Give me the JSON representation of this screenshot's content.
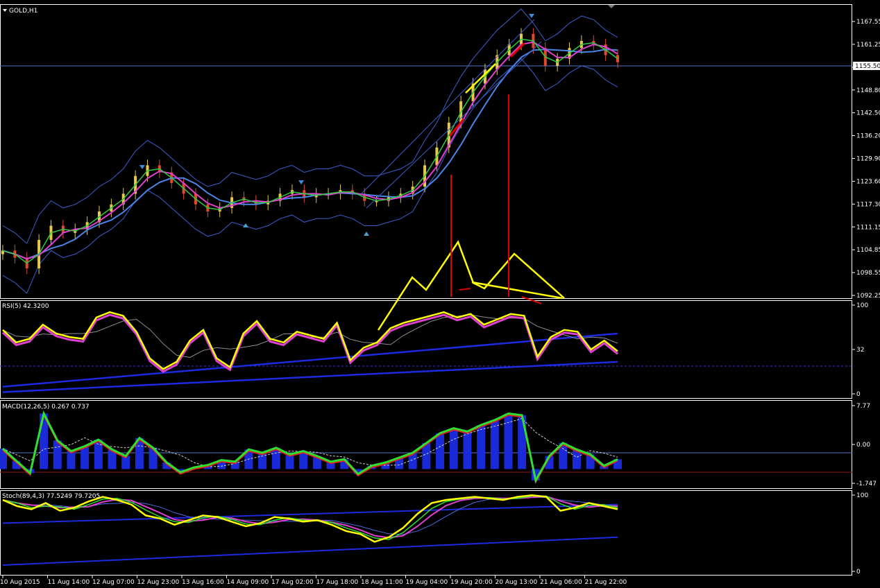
{
  "symbol_label": "GOLD,H1",
  "current_price": "1155.50",
  "chart_data": [
    {
      "type": "line",
      "panel": "price",
      "title": "GOLD,H1",
      "ylim": [
        1090,
        1170
      ],
      "y_ticks": [
        "1167.55",
        "1161.25",
        "1155.50",
        "1148.80",
        "1142.50",
        "1136.20",
        "1129.90",
        "1123.60",
        "1117.30",
        "1111.15",
        "1104.85",
        "1098.55",
        "1092.25"
      ],
      "x_ticks": [
        "10 Aug 2015",
        "11 Aug 14:00",
        "12 Aug 07:00",
        "12 Aug 23:00",
        "13 Aug 16:00",
        "14 Aug 09:00",
        "17 Aug 02:00",
        "17 Aug 18:00",
        "18 Aug 11:00",
        "19 Aug 04:00",
        "19 Aug 20:00",
        "20 Aug 13:00",
        "21 Aug 06:00",
        "21 Aug 22:00"
      ],
      "series": [
        {
          "values": [
            1103,
            1101,
            1098,
            1106,
            1110,
            1108,
            1109,
            1111,
            1114,
            1116,
            1119,
            1124,
            1127,
            1125,
            1122,
            1119,
            1116,
            1114,
            1115,
            1118,
            1117,
            1116,
            1117,
            1119,
            1120,
            1118,
            1119,
            1119,
            1120,
            1119,
            1117,
            1117,
            1118,
            1119,
            1121,
            1127,
            1132,
            1139,
            1145,
            1150,
            1154,
            1158,
            1161,
            1164,
            1160,
            1155,
            1157,
            1160,
            1162,
            1161,
            1158,
            1156
          ]
        }
      ]
    },
    {
      "type": "line",
      "panel": "rsi",
      "title": "RSI(5) 42.3200",
      "ylim": [
        0,
        100
      ],
      "y_ticks": [
        "100",
        "32",
        "0"
      ],
      "series": [
        {
          "values": [
            72,
            58,
            62,
            78,
            68,
            64,
            62,
            86,
            92,
            88,
            70,
            40,
            28,
            36,
            60,
            72,
            40,
            30,
            68,
            82,
            62,
            58,
            70,
            66,
            62,
            80,
            38,
            52,
            58,
            74,
            80,
            84,
            88,
            92,
            86,
            90,
            78,
            84,
            90,
            88,
            42,
            64,
            72,
            70,
            50,
            60,
            48
          ]
        }
      ]
    },
    {
      "type": "line",
      "panel": "macd",
      "title": "MACD(12,26,5) 0.267 0.737",
      "ylim": [
        -1.747,
        7.77
      ],
      "y_ticks": [
        "7.77",
        "0.00",
        "-1.747"
      ],
      "series": [
        {
          "values": [
            2.5,
            1.0,
            -0.5,
            6.8,
            3.5,
            2.2,
            2.8,
            3.6,
            2.4,
            1.6,
            3.8,
            2.6,
            0.8,
            -0.4,
            0.2,
            0.5,
            1.1,
            0.9,
            2.4,
            2.0,
            2.6,
            1.8,
            2.2,
            1.6,
            0.9,
            1.2,
            -0.6,
            0.4,
            0.8,
            1.4,
            2.0,
            3.2,
            4.4,
            5.0,
            4.6,
            5.4,
            6.0,
            6.8,
            6.6,
            -1.4,
            1.6,
            3.2,
            2.4,
            1.8,
            0.4,
            1.2
          ]
        }
      ]
    },
    {
      "type": "line",
      "panel": "stoch",
      "title": "Stoch(89,4,3) 77.5249 79.7205",
      "ylim": [
        0,
        100
      ],
      "y_ticks": [
        "100",
        "0"
      ],
      "series": [
        {
          "values": [
            92,
            84,
            80,
            88,
            78,
            82,
            90,
            96,
            92,
            86,
            72,
            68,
            60,
            66,
            72,
            70,
            64,
            58,
            62,
            70,
            68,
            64,
            66,
            60,
            52,
            48,
            38,
            44,
            56,
            74,
            88,
            92,
            94,
            96,
            94,
            92,
            96,
            98,
            96,
            78,
            82,
            88,
            84,
            80
          ]
        }
      ]
    }
  ]
}
